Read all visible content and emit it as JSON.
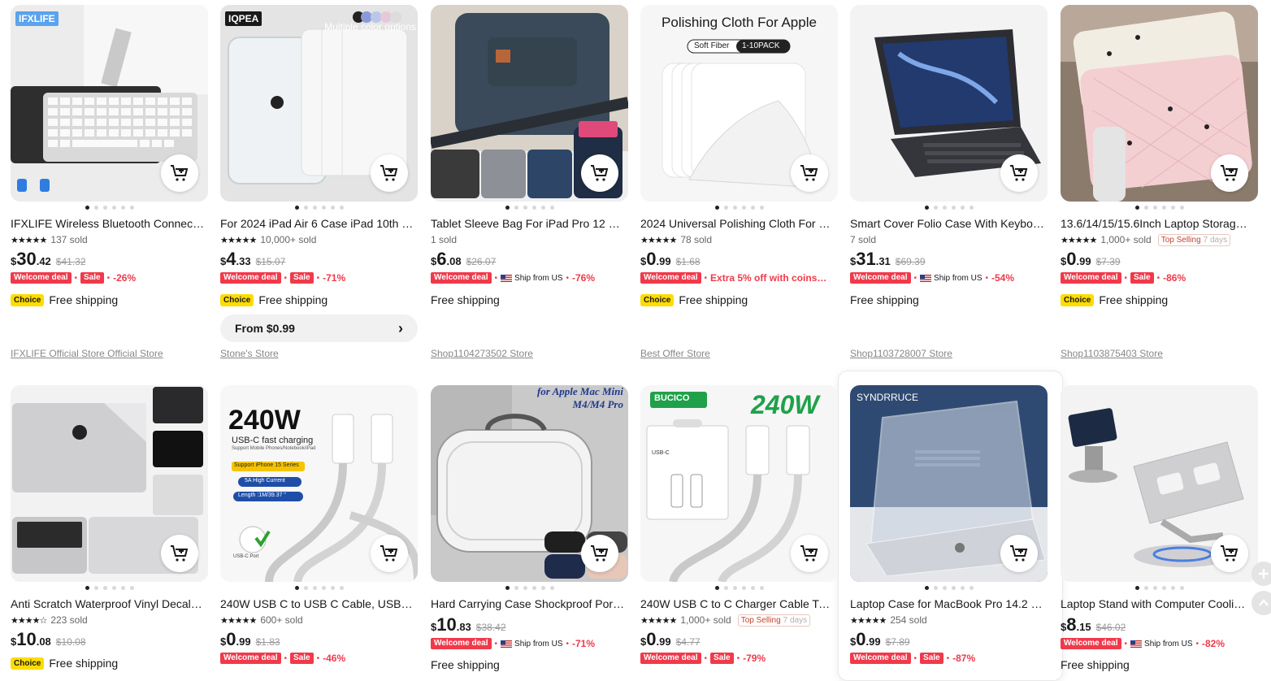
{
  "products": [
    {
      "title": "IFXLIFE Wireless Bluetooth Connect…",
      "stars": "★★★★★",
      "sold": "137 sold",
      "price": {
        "cur": "$",
        "int": "30",
        "dec": ".42"
      },
      "orig": "$41.32",
      "welcome": "Welcome deal",
      "sale": "Sale",
      "discount": "-26%",
      "choice": "Choice",
      "shipping": "Free shipping",
      "store": "IFXLIFE Official Store Official Store",
      "image_tag": "IFXLIFE"
    },
    {
      "title": "For 2024 iPad Air 6 Case iPad 10th …",
      "stars": "★★★★★",
      "sold": "10,000+ sold",
      "price": {
        "cur": "$",
        "int": "4",
        "dec": ".33"
      },
      "orig": "$15.07",
      "welcome": "Welcome deal",
      "sale": "Sale",
      "discount": "-71%",
      "choice": "Choice",
      "shipping": "Free shipping",
      "from": "From $0.99",
      "store": "Stone's Store",
      "image_tag": "IQPEA",
      "image_note": "Multiple color options"
    },
    {
      "title": "Tablet Sleeve Bag For iPad Pro 12 9 …",
      "sold": "1 sold",
      "price": {
        "cur": "$",
        "int": "6",
        "dec": ".08"
      },
      "orig": "$26.07",
      "welcome": "Welcome deal",
      "ship_from": "Ship from US",
      "discount": "-76%",
      "shipping": "Free shipping",
      "store": "Shop1104273502 Store"
    },
    {
      "title": "2024 Universal Polishing Cloth For …",
      "stars": "★★★★★",
      "sold": "78 sold",
      "price": {
        "cur": "$",
        "int": "0",
        "dec": ".99"
      },
      "orig": "$1.68",
      "welcome": "Welcome deal",
      "extra": "Extra 5% off with coins…",
      "choice": "Choice",
      "shipping": "Free shipping",
      "store": "Best Offer Store",
      "image_title": "Polishing Cloth For Apple",
      "image_chip_a": "Soft Fiber",
      "image_chip_b": "1-10PACK"
    },
    {
      "title": "Smart Cover Folio Case With Keybo…",
      "sold": "7 sold",
      "price": {
        "cur": "$",
        "int": "31",
        "dec": ".31"
      },
      "orig": "$69.39",
      "welcome": "Welcome deal",
      "ship_from": "Ship from US",
      "discount": "-54%",
      "shipping": "Free shipping",
      "store": "Shop1103728007 Store"
    },
    {
      "title": "13.6/14/15/15.6Inch Laptop Storag…",
      "stars": "★★★★★",
      "sold": "1,000+ sold",
      "top_selling": "Top Selling",
      "top_days": "7 days",
      "price": {
        "cur": "$",
        "int": "0",
        "dec": ".99"
      },
      "orig": "$7.39",
      "welcome": "Welcome deal",
      "sale": "Sale",
      "discount": "-86%",
      "choice": "Choice",
      "shipping": "Free shipping",
      "store": "Shop1103875403 Store"
    },
    {
      "title": "Anti Scratch Waterproof Vinyl Decal…",
      "stars": "★★★★☆",
      "sold": "223 sold",
      "price": {
        "cur": "$",
        "int": "10",
        "dec": ".08"
      },
      "orig": "$10.08",
      "choice": "Choice",
      "shipping": "Free shipping"
    },
    {
      "title": "240W USB C to USB C Cable, USB C …",
      "stars": "★★★★★",
      "sold": "600+ sold",
      "price": {
        "cur": "$",
        "int": "0",
        "dec": ".99"
      },
      "orig": "$1.83",
      "welcome": "Welcome deal",
      "sale": "Sale",
      "discount": "-46%",
      "image_big": "240W",
      "image_sub": "USB-C fast charging",
      "image_small": "Support Mobile Phones/Notebook/iPad",
      "image_chip1": "Support iPhone 15 Series",
      "image_chip2": "5A High Current",
      "image_chip3": "Length :1M/39.37 \"",
      "image_port": "USB-C Port"
    },
    {
      "title": "Hard Carrying Case Shockproof Por…",
      "price": {
        "cur": "$",
        "int": "10",
        "dec": ".83"
      },
      "orig": "$38.42",
      "welcome": "Welcome deal",
      "ship_from": "Ship from US",
      "discount": "-71%",
      "shipping": "Free shipping",
      "image_title1": "for Apple Mac Mini",
      "image_title2": "M4/M4 Pro"
    },
    {
      "title": "240W USB C to C Charger Cable Typ…",
      "stars": "★★★★★",
      "sold": "1,000+ sold",
      "top_selling": "Top Selling",
      "top_days": "7 days",
      "price": {
        "cur": "$",
        "int": "0",
        "dec": ".99"
      },
      "orig": "$4.77",
      "welcome": "Welcome deal",
      "sale": "Sale",
      "discount": "-79%",
      "image_brand": "BUCICO",
      "image_big": "240W",
      "image_box": "USB-C"
    },
    {
      "title": "Laptop Case for MacBook Pro 14.2 …",
      "stars": "★★★★★",
      "sold": "254 sold",
      "price": {
        "cur": "$",
        "int": "0",
        "dec": ".99"
      },
      "orig": "$7.89",
      "welcome": "Welcome deal",
      "sale": "Sale",
      "discount": "-87%",
      "image_brand": "SYNDRRUCE"
    },
    {
      "title": "Laptop Stand with Computer Cooli…",
      "price": {
        "cur": "$",
        "int": "8",
        "dec": ".15"
      },
      "orig": "$46.02",
      "welcome": "Welcome deal",
      "ship_from": "Ship from US",
      "discount": "-82%",
      "shipping": "Free shipping"
    }
  ],
  "icons": {
    "cart": "add-to-cart-icon",
    "flag": "us-flag-icon",
    "chevron": "chevron-right-icon",
    "plus": "plus-icon",
    "up": "chevron-up-icon"
  },
  "chevron_glyph": "›"
}
